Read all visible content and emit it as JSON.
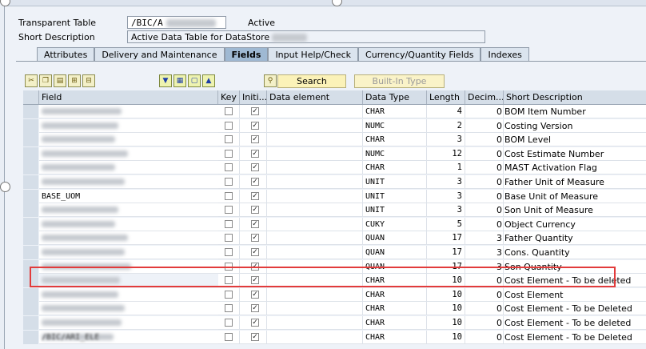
{
  "header": {
    "table_type_label": "Transparent Table",
    "table_name_prefix": "/BIC/A",
    "status": "Active",
    "short_desc_label": "Short Description",
    "short_desc_value": "Active Data Table for DataStore"
  },
  "tabs": [
    {
      "label": "Attributes",
      "active": false
    },
    {
      "label": "Delivery and Maintenance",
      "active": false
    },
    {
      "label": "Fields",
      "active": true
    },
    {
      "label": "Input Help/Check",
      "active": false
    },
    {
      "label": "Currency/Quantity Fields",
      "active": false
    },
    {
      "label": "Indexes",
      "active": false
    }
  ],
  "toolbar": {
    "search_label": "Search",
    "builtin_type_label": "Built-In Type"
  },
  "columns": {
    "field": "Field",
    "key": "Key",
    "initial": "Initi...",
    "data_element": "Data element",
    "data_type": "Data Type",
    "length": "Length",
    "decimals": "Decim...",
    "short_description": "Short Description"
  },
  "rows": [
    {
      "field": "",
      "blurred": true,
      "key": false,
      "initial": true,
      "data_type": "CHAR",
      "length": "4",
      "decimals": "0",
      "short_description": "BOM Item Number"
    },
    {
      "field": "",
      "blurred": true,
      "key": false,
      "initial": true,
      "data_type": "NUMC",
      "length": "2",
      "decimals": "0",
      "short_description": "Costing Version"
    },
    {
      "field": "",
      "blurred": true,
      "key": false,
      "initial": true,
      "data_type": "CHAR",
      "length": "3",
      "decimals": "0",
      "short_description": "BOM Level"
    },
    {
      "field": "",
      "blurred": true,
      "key": false,
      "initial": true,
      "data_type": "NUMC",
      "length": "12",
      "decimals": "0",
      "short_description": "Cost Estimate Number"
    },
    {
      "field": "",
      "blurred": true,
      "key": false,
      "initial": true,
      "data_type": "CHAR",
      "length": "1",
      "decimals": "0",
      "short_description": "MAST Activation Flag"
    },
    {
      "field": "",
      "blurred": true,
      "key": false,
      "initial": true,
      "data_type": "UNIT",
      "length": "3",
      "decimals": "0",
      "short_description": "Father Unit of Measure"
    },
    {
      "field": "BASE_UOM",
      "blurred": false,
      "key": false,
      "initial": true,
      "data_type": "UNIT",
      "length": "3",
      "decimals": "0",
      "short_description": "Base Unit of Measure"
    },
    {
      "field": "",
      "blurred": true,
      "key": false,
      "initial": true,
      "data_type": "UNIT",
      "length": "3",
      "decimals": "0",
      "short_description": "Son Unit of Measure"
    },
    {
      "field": "",
      "blurred": true,
      "key": false,
      "initial": true,
      "data_type": "CUKY",
      "length": "5",
      "decimals": "0",
      "short_description": "Object Currency"
    },
    {
      "field": "",
      "blurred": true,
      "key": false,
      "initial": true,
      "data_type": "QUAN",
      "length": "17",
      "decimals": "3",
      "short_description": "Father Quantity"
    },
    {
      "field": "",
      "blurred": true,
      "key": false,
      "initial": true,
      "data_type": "QUAN",
      "length": "17",
      "decimals": "3",
      "short_description": "Cons. Quantity"
    },
    {
      "field": "",
      "blurred": true,
      "key": false,
      "initial": true,
      "data_type": "QUAN",
      "length": "17",
      "decimals": "3",
      "short_description": "Son Quantity"
    },
    {
      "field": "",
      "blurred": true,
      "key": false,
      "initial": true,
      "data_type": "CHAR",
      "length": "10",
      "decimals": "0",
      "short_description": "Cost Element - To be deleted"
    },
    {
      "field": "",
      "blurred": true,
      "key": false,
      "initial": true,
      "data_type": "CHAR",
      "length": "10",
      "decimals": "0",
      "short_description": "Cost Element"
    },
    {
      "field": "",
      "blurred": true,
      "key": false,
      "initial": true,
      "data_type": "CHAR",
      "length": "10",
      "decimals": "0",
      "short_description": "Cost Element - To be Deleted"
    },
    {
      "field": "",
      "blurred": true,
      "key": false,
      "initial": true,
      "data_type": "CHAR",
      "length": "10",
      "decimals": "0",
      "short_description": "Cost Element - To be deleted"
    },
    {
      "field": "/BIC/ARI_ELE",
      "blurred": true,
      "key": false,
      "initial": true,
      "data_type": "CHAR",
      "length": "10",
      "decimals": "0",
      "short_description": "Cost Element - To be Deleted"
    }
  ],
  "highlighted_row_index": 12,
  "colors": {
    "highlight": "#e23b3b",
    "active_tab": "#9fb9d3",
    "header_bg": "#d5dee8"
  }
}
